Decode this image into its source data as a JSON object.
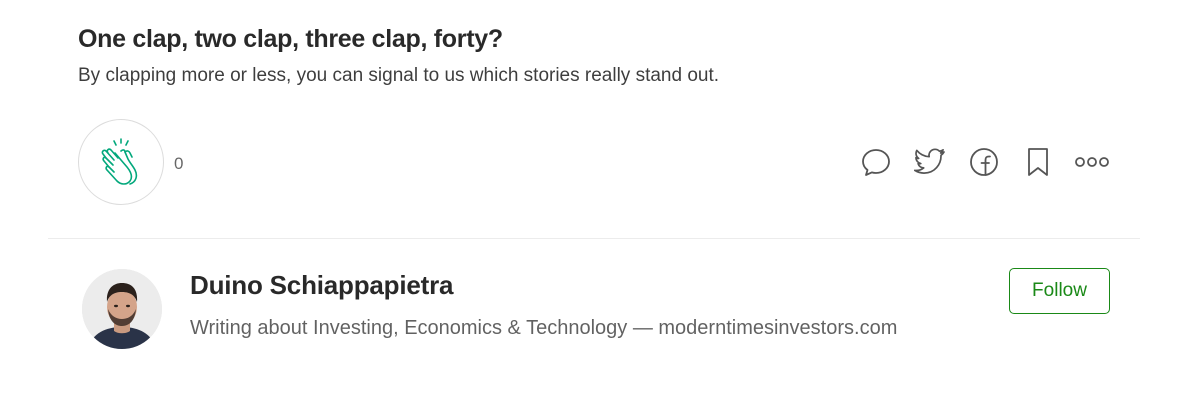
{
  "prompt": {
    "title": "One clap, two clap, three clap, forty?",
    "subtitle": "By clapping more or less, you can signal to us which stories really stand out."
  },
  "claps": {
    "count": "0",
    "icon": "clap-icon"
  },
  "actions": [
    {
      "icon": "comment-icon"
    },
    {
      "icon": "twitter-icon"
    },
    {
      "icon": "facebook-icon"
    },
    {
      "icon": "bookmark-icon"
    },
    {
      "icon": "more-icon"
    }
  ],
  "author": {
    "name": "Duino Schiappapietra",
    "bio": "Writing about Investing, Economics & Technology — moderntimesinvestors.com",
    "follow_label": "Follow"
  },
  "colors": {
    "accent": "#1a8917",
    "clap_icon": "#03a87c",
    "icon_gray": "#555555"
  }
}
